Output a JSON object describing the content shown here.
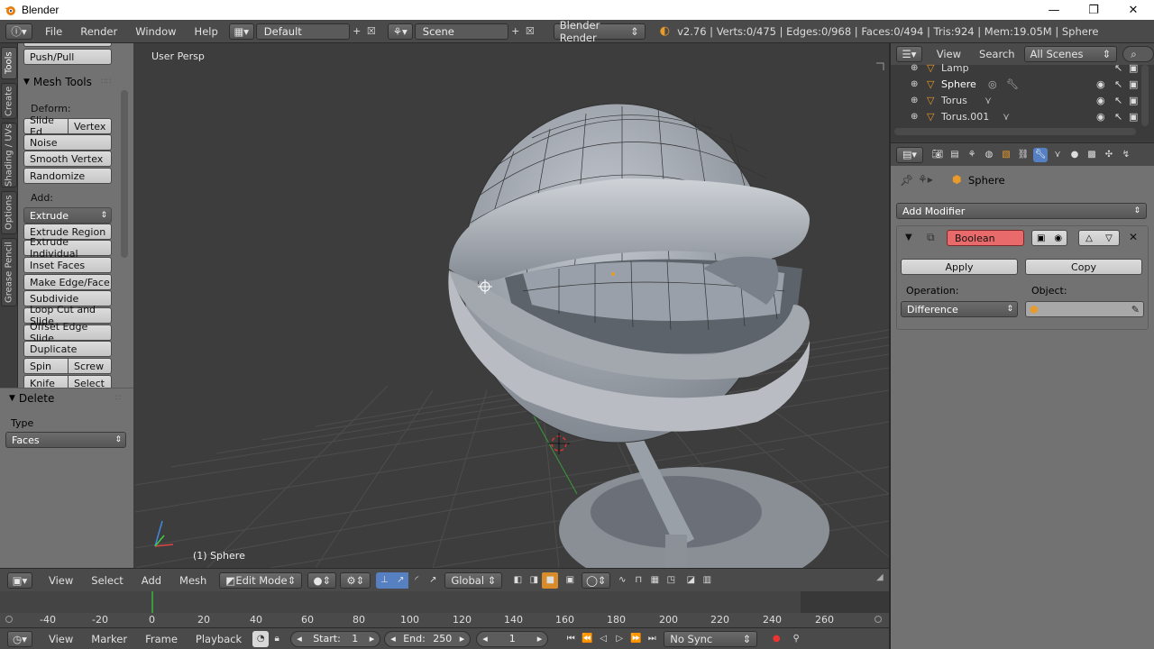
{
  "window": {
    "title": "Blender",
    "minimize": "—",
    "maximize": "❐",
    "close": "✕"
  },
  "infobar": {
    "menus": [
      "File",
      "Render",
      "Window",
      "Help"
    ],
    "screen_layout": "Default",
    "scene": "Scene",
    "render_engine": "Blender Render",
    "stats": "v2.76 | Verts:0/475 | Edges:0/968 | Faces:0/494 | Tris:924 | Mem:19.05M | Sphere"
  },
  "shelf": {
    "tabs": [
      "Tools",
      "Create",
      "Shading / UVs",
      "Options",
      "Grease Pencil"
    ],
    "top_button": "Push/Pull",
    "panel_title": "Mesh Tools",
    "deform_label": "Deform:",
    "slide_edge": "Slide Ed",
    "vertex": "Vertex",
    "noise": "Noise",
    "smooth_vertex": "Smooth Vertex",
    "randomize": "Randomize",
    "add_label": "Add:",
    "extrude": "Extrude",
    "extrude_region": "Extrude Region",
    "extrude_individual": "Extrude Individual",
    "inset_faces": "Inset Faces",
    "make_edge_face": "Make Edge/Face",
    "subdivide": "Subdivide",
    "loop_cut": "Loop Cut and Slide",
    "offset_edge": "Offset Edge Slide",
    "duplicate": "Duplicate",
    "spin": "Spin",
    "screw": "Screw",
    "knife": "Knife",
    "select": "Select"
  },
  "operator": {
    "title": "Delete",
    "type_label": "Type",
    "type_value": "Faces"
  },
  "viewport": {
    "view_label": "User Persp",
    "object_label": "(1) Sphere"
  },
  "viewport_header": {
    "view": "View",
    "select": "Select",
    "add": "Add",
    "mesh": "Mesh",
    "mode": "Edit Mode",
    "orientation": "Global"
  },
  "timeline": {
    "ticks": [
      "-40",
      "-20",
      "0",
      "20",
      "40",
      "60",
      "80",
      "100",
      "120",
      "140",
      "160",
      "180",
      "200",
      "220",
      "240",
      "260"
    ],
    "view": "View",
    "marker": "Marker",
    "frame": "Frame",
    "playback": "Playback",
    "start_label": "Start:",
    "start_value": "1",
    "end_label": "End:",
    "end_value": "250",
    "current_frame": "1",
    "sync": "No Sync"
  },
  "outliner": {
    "view": "View",
    "search": "Search",
    "filter": "All Scenes",
    "items": [
      "Lamp",
      "Sphere",
      "Torus",
      "Torus.001"
    ]
  },
  "properties": {
    "breadcrumb": "Sphere",
    "add_modifier": "Add Modifier",
    "modifier_name": "Boolean",
    "apply": "Apply",
    "copy": "Copy",
    "operation_label": "Operation:",
    "operation_value": "Difference",
    "object_label": "Object:"
  },
  "colors": {
    "modifier_name_bg": "#e86a6a",
    "selection_blue": "#5680c2"
  }
}
